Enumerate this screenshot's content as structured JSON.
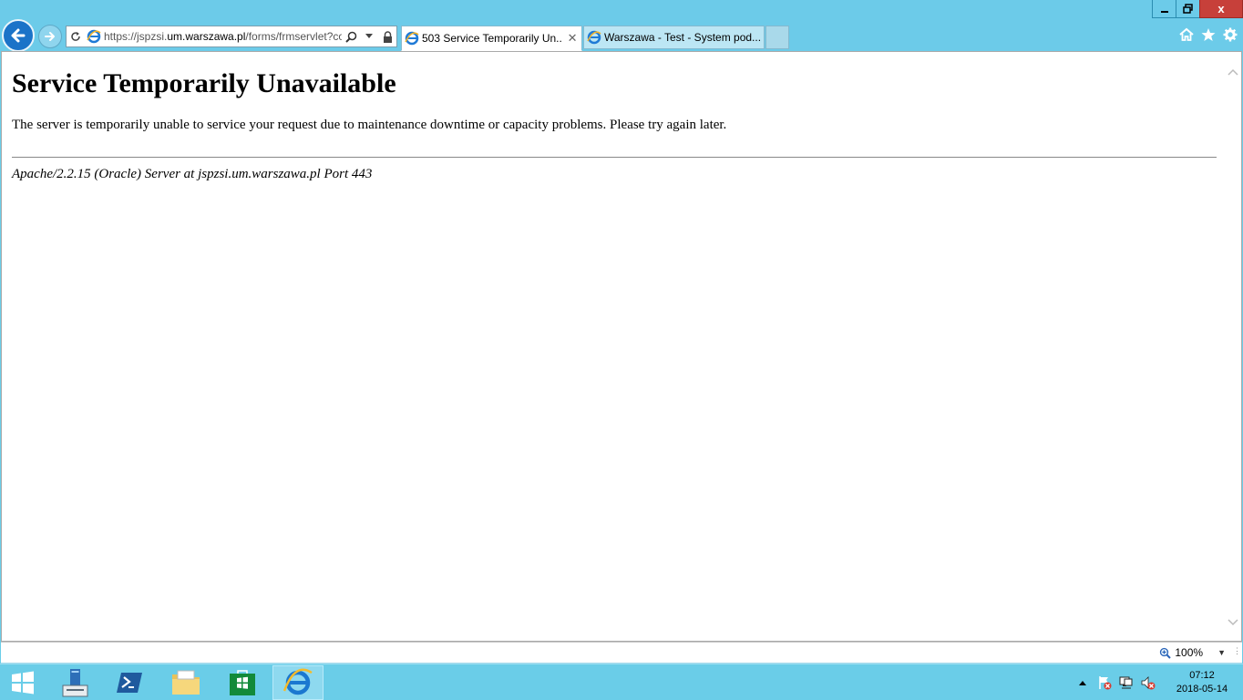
{
  "browser": {
    "address_url_prefix": "https://jspzsi.",
    "address_url_host": "um.warszawa.pl",
    "address_url_suffix": "/forms/frmservlet?cor",
    "tabs": [
      {
        "label": "503 Service Temporarily Un...",
        "close": "✕"
      },
      {
        "label": "Warszawa - Test - System pod..."
      }
    ],
    "window_close_label": "x"
  },
  "page": {
    "heading": "Service Temporarily Unavailable",
    "message": "The server is temporarily unable to service your request due to maintenance downtime or capacity problems. Please try again later.",
    "signature": "Apache/2.2.15 (Oracle) Server at jspzsi.um.warszawa.pl Port 443"
  },
  "statusbar": {
    "zoom": "100%"
  },
  "taskbar": {
    "time": "07:12",
    "date": "2018-05-14"
  },
  "colors": {
    "chrome": "#6ccbe9",
    "back_button": "#1b73c8",
    "close_button": "#c7403a"
  }
}
